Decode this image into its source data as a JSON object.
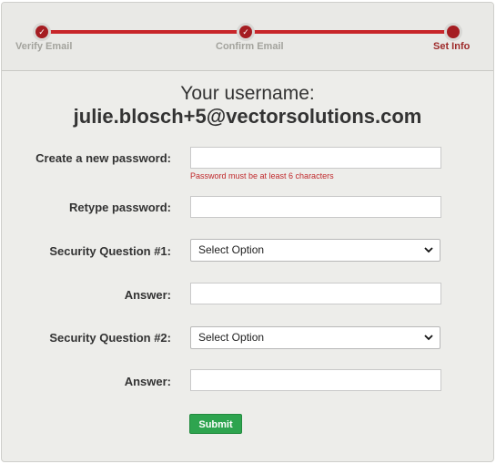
{
  "stepper": {
    "steps": [
      {
        "label": "Verify Email",
        "state": "complete"
      },
      {
        "label": "Confirm Email",
        "state": "complete"
      },
      {
        "label": "Set Info",
        "state": "active"
      }
    ]
  },
  "header": {
    "username_label": "Your username:",
    "username": "julie.blosch+5@vectorsolutions.com"
  },
  "form": {
    "new_password_label": "Create a new password:",
    "new_password_value": "",
    "password_hint": "Password must be at least 6 characters",
    "retype_password_label": "Retype password:",
    "retype_password_value": "",
    "security_q1_label": "Security Question #1:",
    "security_q1_selected": "Select Option",
    "answer1_label": "Answer:",
    "answer1_value": "",
    "security_q2_label": "Security Question #2:",
    "security_q2_selected": "Select Option",
    "answer2_label": "Answer:",
    "answer2_value": "",
    "submit_label": "Submit"
  },
  "colors": {
    "accent": "#c8262a",
    "submit": "#2ea44f",
    "hint": "#c0282b"
  }
}
